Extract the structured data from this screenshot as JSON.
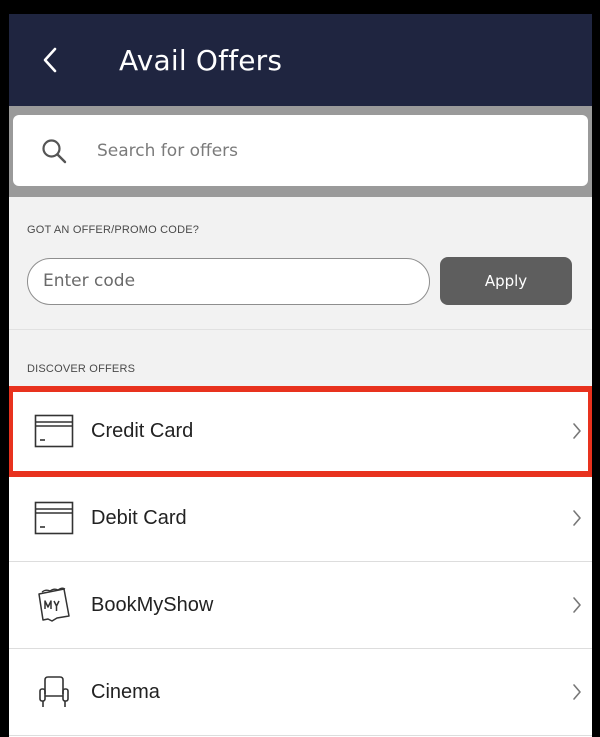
{
  "header": {
    "title": "Avail Offers",
    "back_icon": "chevron-left-icon"
  },
  "search": {
    "placeholder": "Search for offers",
    "icon": "search-icon"
  },
  "promo": {
    "section_label": "GOT AN OFFER/PROMO CODE?",
    "input_placeholder": "Enter code",
    "apply_label": "Apply"
  },
  "discover": {
    "section_label": "DISCOVER OFFERS",
    "items": [
      {
        "label": "Credit Card",
        "icon": "credit-card-icon",
        "highlighted": true
      },
      {
        "label": "Debit Card",
        "icon": "debit-card-icon",
        "highlighted": false
      },
      {
        "label": "BookMyShow",
        "icon": "bookmyshow-icon",
        "highlighted": false
      },
      {
        "label": "Cinema",
        "icon": "cinema-seat-icon",
        "highlighted": false
      }
    ]
  },
  "colors": {
    "header_bg": "#1f2540",
    "highlight": "#e8321e",
    "apply_bg": "#5e5e5e",
    "section_bg": "#f2f2f2"
  }
}
